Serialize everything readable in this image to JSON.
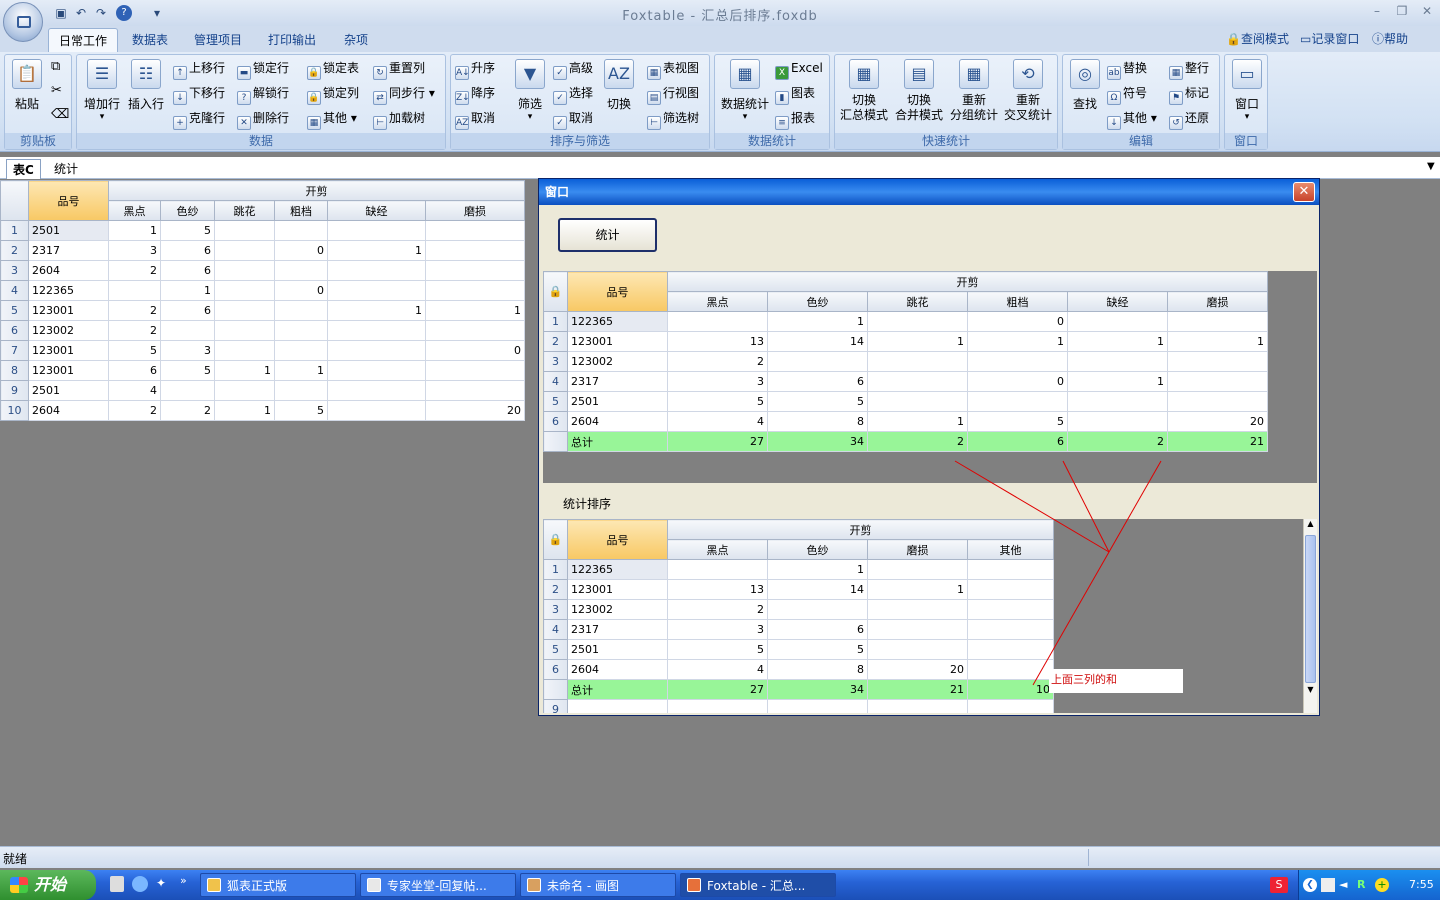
{
  "app": {
    "title": "Foxtable - 汇总后排序.foxdb"
  },
  "ribbon_tabs": [
    "日常工作",
    "数据表",
    "管理项目",
    "打印输出",
    "杂项"
  ],
  "top_right": {
    "view_mode": "查阅模式",
    "record_window": "记录窗口",
    "help": "帮助"
  },
  "groups": {
    "clipboard": {
      "label": "剪贴板",
      "paste": "粘贴"
    },
    "data": {
      "label": "数据",
      "add_row": "增加行",
      "insert_row": "插入行",
      "move_up": "上移行",
      "move_down": "下移行",
      "clone_row": "克隆行",
      "lock_row": "锁定行",
      "unlock_row": "解锁行",
      "delete_row": "删除行",
      "lock_table": "锁定表",
      "lock_col": "锁定列",
      "other": "其他",
      "reset_col": "重置列",
      "sync_row": "同步行",
      "load_tree": "加载树"
    },
    "sort": {
      "label": "排序与筛选",
      "asc": "升序",
      "desc": "降序",
      "cancel": "取消",
      "filter": "筛选",
      "advanced": "高级",
      "select": "选择",
      "cancel2": "取消",
      "switch": "切换",
      "table_view": "表视图",
      "row_view": "行视图",
      "filter_tree": "筛选树"
    },
    "stats": {
      "label": "数据统计",
      "data_stats": "数据统计",
      "excel": "Excel",
      "chart": "图表",
      "report": "报表"
    },
    "quick": {
      "label": "快速统计",
      "b1": "切换\n汇总模式",
      "b2": "切换\n合并模式",
      "b3": "重新\n分组统计",
      "b4": "重新\n交叉统计"
    },
    "edit": {
      "label": "编辑",
      "find": "查找",
      "replace": "替换",
      "symbol": "符号",
      "other": "其他",
      "whole_row": "整行",
      "mark": "标记",
      "restore": "还原"
    },
    "window": {
      "label": "窗口",
      "window": "窗口"
    }
  },
  "sheet_tabs": [
    "表C",
    "统计"
  ],
  "headers": {
    "pinhao": "品号",
    "kaijian": "开剪",
    "cols": [
      "黑点",
      "色纱",
      "跳花",
      "粗档",
      "缺经",
      "磨损"
    ]
  },
  "main_rows": [
    [
      "2501",
      "1",
      "5",
      "",
      "",
      "",
      ""
    ],
    [
      "2317",
      "3",
      "6",
      "",
      "0",
      "1",
      ""
    ],
    [
      "2604",
      "2",
      "6",
      "",
      "",
      "",
      ""
    ],
    [
      "122365",
      "",
      "1",
      "",
      "0",
      "",
      ""
    ],
    [
      "123001",
      "2",
      "6",
      "",
      "",
      "1",
      "1"
    ],
    [
      "123002",
      "2",
      "",
      "",
      "",
      "",
      ""
    ],
    [
      "123001",
      "5",
      "3",
      "",
      "",
      "",
      "0"
    ],
    [
      "123001",
      "6",
      "5",
      "1",
      "1",
      "",
      ""
    ],
    [
      "2501",
      "4",
      "",
      "",
      "",
      "",
      ""
    ],
    [
      "2604",
      "2",
      "2",
      "1",
      "5",
      "",
      "20"
    ]
  ],
  "window": {
    "title": "窗口",
    "stat_button": "统计",
    "sort_label": "统计排序",
    "annotation": "上面三列的和"
  },
  "stat_rows": [
    [
      "122365",
      "",
      "1",
      "",
      "0",
      "",
      ""
    ],
    [
      "123001",
      "13",
      "14",
      "1",
      "1",
      "1",
      "1"
    ],
    [
      "123002",
      "2",
      "",
      "",
      "",
      "",
      ""
    ],
    [
      "2317",
      "3",
      "6",
      "",
      "0",
      "1",
      ""
    ],
    [
      "2501",
      "5",
      "5",
      "",
      "",
      "",
      ""
    ],
    [
      "2604",
      "4",
      "8",
      "1",
      "5",
      "",
      "20"
    ]
  ],
  "stat_total": [
    "总计",
    "27",
    "34",
    "2",
    "6",
    "2",
    "21"
  ],
  "sort_headers": {
    "cols": [
      "黑点",
      "色纱",
      "磨损",
      "其他"
    ]
  },
  "sort_rows": [
    [
      "122365",
      "",
      "1",
      ""
    ],
    [
      "123001",
      "13",
      "14",
      "1"
    ],
    [
      "123002",
      "2",
      "",
      ""
    ],
    [
      "2317",
      "3",
      "6",
      ""
    ],
    [
      "2501",
      "5",
      "5",
      ""
    ],
    [
      "2604",
      "4",
      "8",
      "20"
    ]
  ],
  "sort_total": [
    "总计",
    "27",
    "34",
    "21",
    "10"
  ],
  "sort_next_row": "9",
  "statusbar": {
    "text": "就绪"
  },
  "taskbar": {
    "start": "开始",
    "tasks": [
      "狐表正式版",
      "专家坐堂-回复帖...",
      "未命名 - 画图",
      "Foxtable - 汇总..."
    ],
    "clock": "7:55"
  }
}
